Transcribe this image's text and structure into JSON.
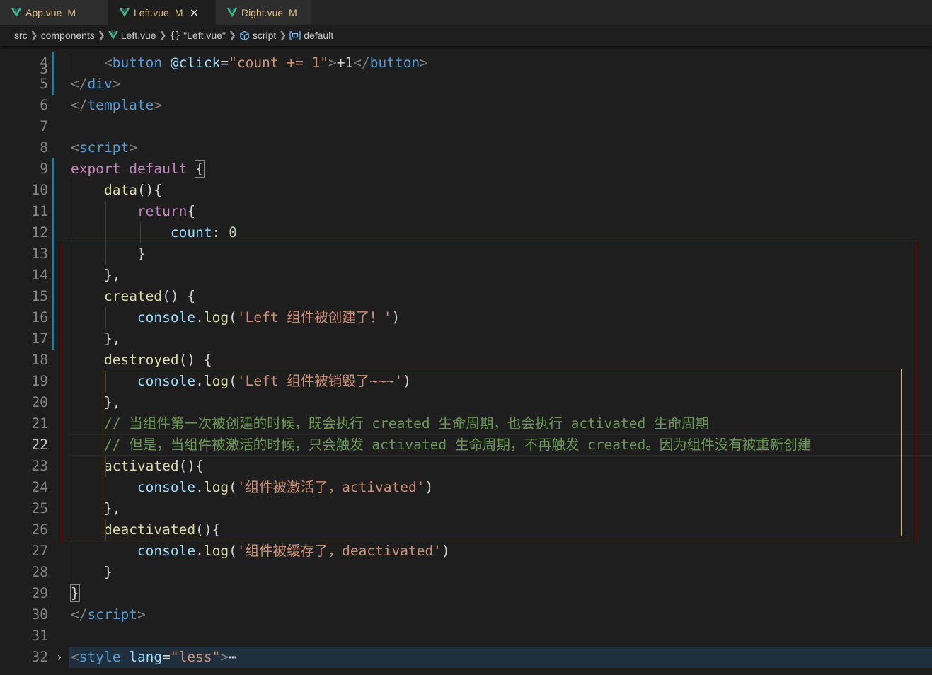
{
  "tabs": [
    {
      "name": "App.vue",
      "status": "M",
      "active": false
    },
    {
      "name": "Left.vue",
      "status": "M",
      "active": true,
      "close": "×"
    },
    {
      "name": "Right.vue",
      "status": "M",
      "active": false
    }
  ],
  "breadcrumb": [
    "src",
    "components",
    "Left.vue",
    "\"Left.vue\"",
    "script",
    "default"
  ],
  "icons": {
    "vue": "vue-logo-icon",
    "braces": "{}",
    "script": "cube-icon",
    "default": "symbol-variable-icon",
    "fold": "chevron-right-icon"
  },
  "colors": {
    "accent": "#1b81a8",
    "red_box": "#e51400",
    "yellow_box": "#e5c01a",
    "vue_green": "#41b883"
  },
  "editor": {
    "current_line": 22,
    "lines": [
      {
        "n": "4",
        "segs": [
          [
            "txt",
            "    "
          ],
          [
            "punc",
            "<"
          ],
          [
            "tag",
            "button"
          ],
          [
            "txt",
            " "
          ],
          [
            "attr",
            "@click"
          ],
          [
            "txt",
            "="
          ],
          [
            "str",
            "\"count"
          ],
          [
            "txt",
            " "
          ],
          [
            "str",
            "+="
          ],
          [
            "txt",
            " "
          ],
          [
            "str",
            "1\""
          ],
          [
            "punc",
            ">"
          ],
          [
            "txt",
            "+1"
          ],
          [
            "punc",
            "</"
          ],
          [
            "tag",
            "button"
          ],
          [
            "punc",
            ">"
          ]
        ]
      },
      {
        "n": "5",
        "segs": [
          [
            "punc",
            "</"
          ],
          [
            "tag",
            "div"
          ],
          [
            "punc",
            ">"
          ]
        ]
      },
      {
        "n": "6",
        "segs": [
          [
            "punc",
            "</"
          ],
          [
            "tag",
            "template"
          ],
          [
            "punc",
            ">"
          ]
        ]
      },
      {
        "n": "7",
        "segs": []
      },
      {
        "n": "8",
        "segs": [
          [
            "punc",
            "<"
          ],
          [
            "tag",
            "script"
          ],
          [
            "punc",
            ">"
          ]
        ]
      },
      {
        "n": "9",
        "segs": [
          [
            "kw",
            "export"
          ],
          [
            "txt",
            " "
          ],
          [
            "kw",
            "default"
          ],
          [
            "txt",
            " "
          ],
          [
            "txt",
            "{"
          ]
        ]
      },
      {
        "n": "10",
        "segs": [
          [
            "txt",
            "    "
          ],
          [
            "fn",
            "data"
          ],
          [
            "txt",
            "(){"
          ]
        ]
      },
      {
        "n": "11",
        "segs": [
          [
            "txt",
            "        "
          ],
          [
            "kw",
            "return"
          ],
          [
            "txt",
            "{"
          ]
        ]
      },
      {
        "n": "12",
        "segs": [
          [
            "txt",
            "            "
          ],
          [
            "var",
            "count"
          ],
          [
            "txt",
            ": "
          ],
          [
            "num",
            "0"
          ]
        ]
      },
      {
        "n": "13",
        "segs": [
          [
            "txt",
            "        }"
          ]
        ]
      },
      {
        "n": "14",
        "segs": [
          [
            "txt",
            "    },"
          ]
        ]
      },
      {
        "n": "15",
        "segs": [
          [
            "txt",
            "    "
          ],
          [
            "fn",
            "created"
          ],
          [
            "txt",
            "() {"
          ]
        ]
      },
      {
        "n": "16",
        "segs": [
          [
            "txt",
            "        "
          ],
          [
            "var",
            "console"
          ],
          [
            "txt",
            "."
          ],
          [
            "fn",
            "log"
          ],
          [
            "txt",
            "("
          ],
          [
            "str",
            "'Left 组件被创建了！'"
          ],
          [
            "txt",
            ")"
          ]
        ]
      },
      {
        "n": "17",
        "segs": [
          [
            "txt",
            "    },"
          ]
        ]
      },
      {
        "n": "18",
        "segs": [
          [
            "txt",
            "    "
          ],
          [
            "fn",
            "destroyed"
          ],
          [
            "txt",
            "() {"
          ]
        ]
      },
      {
        "n": "19",
        "segs": [
          [
            "txt",
            "        "
          ],
          [
            "var",
            "console"
          ],
          [
            "txt",
            "."
          ],
          [
            "fn",
            "log"
          ],
          [
            "txt",
            "("
          ],
          [
            "str",
            "'Left 组件被销毁了~~~'"
          ],
          [
            "txt",
            ")"
          ]
        ]
      },
      {
        "n": "20",
        "segs": [
          [
            "txt",
            "    },"
          ]
        ]
      },
      {
        "n": "21",
        "segs": [
          [
            "txt",
            "    "
          ],
          [
            "cm",
            "// 当组件第一次被创建的时候，既会执行 created 生命周期，也会执行 activated 生命周期"
          ]
        ]
      },
      {
        "n": "22",
        "segs": [
          [
            "txt",
            "    "
          ],
          [
            "cm",
            "// 但是，当组件被激活的时候，只会触发 activated 生命周期，不再触发 created。因为组件没有被重新创建"
          ]
        ]
      },
      {
        "n": "23",
        "segs": [
          [
            "txt",
            "    "
          ],
          [
            "fn",
            "activated"
          ],
          [
            "txt",
            "(){"
          ]
        ]
      },
      {
        "n": "24",
        "segs": [
          [
            "txt",
            "        "
          ],
          [
            "var",
            "console"
          ],
          [
            "txt",
            "."
          ],
          [
            "fn",
            "log"
          ],
          [
            "txt",
            "("
          ],
          [
            "str",
            "'组件被激活了，activated'"
          ],
          [
            "txt",
            ")"
          ]
        ]
      },
      {
        "n": "25",
        "segs": [
          [
            "txt",
            "    },"
          ]
        ]
      },
      {
        "n": "26",
        "segs": [
          [
            "txt",
            "    "
          ],
          [
            "fn",
            "deactivated"
          ],
          [
            "txt",
            "(){"
          ]
        ]
      },
      {
        "n": "27",
        "segs": [
          [
            "txt",
            "        "
          ],
          [
            "var",
            "console"
          ],
          [
            "txt",
            "."
          ],
          [
            "fn",
            "log"
          ],
          [
            "txt",
            "("
          ],
          [
            "str",
            "'组件被缓存了，deactivated'"
          ],
          [
            "txt",
            ")"
          ]
        ]
      },
      {
        "n": "28",
        "segs": [
          [
            "txt",
            "    }"
          ]
        ]
      },
      {
        "n": "29",
        "segs": [
          [
            "txt",
            "}"
          ]
        ]
      },
      {
        "n": "30",
        "segs": [
          [
            "punc",
            "</"
          ],
          [
            "tag",
            "script"
          ],
          [
            "punc",
            ">"
          ]
        ]
      },
      {
        "n": "31",
        "segs": []
      },
      {
        "n": "32",
        "segs": [
          [
            "punc",
            "<"
          ],
          [
            "tag",
            "style"
          ],
          [
            "txt",
            " "
          ],
          [
            "attr",
            "lang"
          ],
          [
            "txt",
            "="
          ],
          [
            "str",
            "\"less\""
          ],
          [
            "punc",
            ">"
          ],
          [
            "txt",
            "⋯"
          ]
        ]
      }
    ]
  }
}
